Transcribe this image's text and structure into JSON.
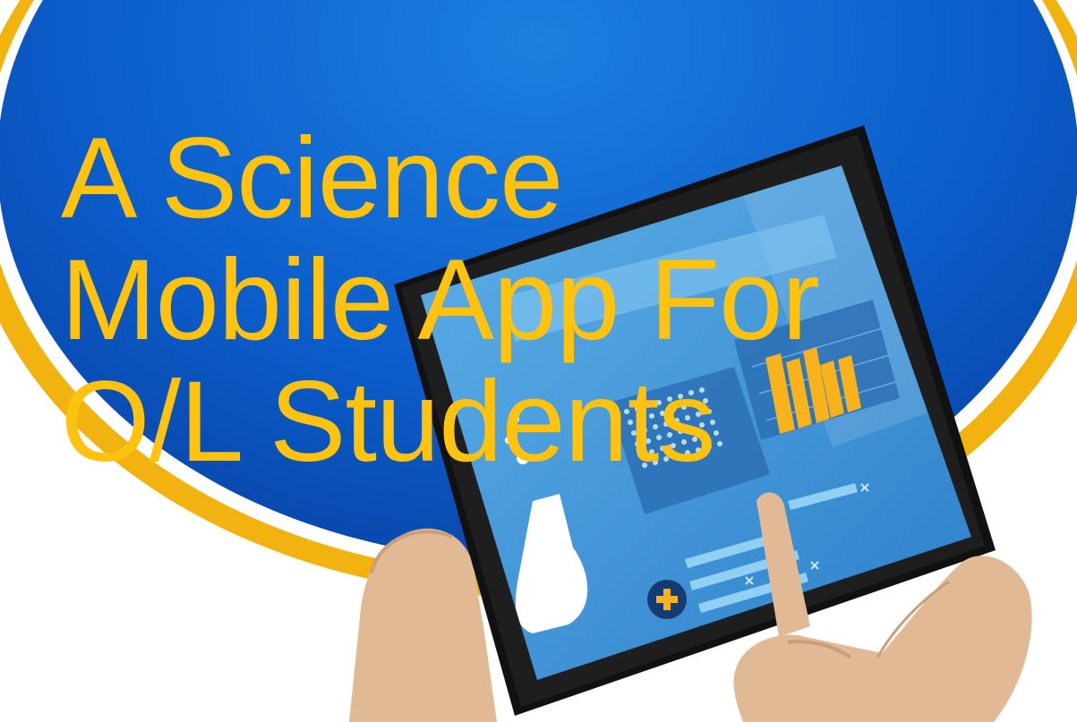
{
  "title": {
    "line1": "A Science",
    "line2": "Mobile App For",
    "line3": "O/L Students"
  },
  "colors": {
    "background_blue": "#0b56c4",
    "ring_gold": "#f2b20f",
    "title_yellow": "#ffc20e",
    "screen_blue": "#3f92d6",
    "tablet_bezel": "#111111",
    "skin": "#e2b995"
  },
  "icons": {
    "add_button": "plus-circle-icon",
    "flask": "flask-icon",
    "bar_chart": "bar-chart-icon"
  }
}
